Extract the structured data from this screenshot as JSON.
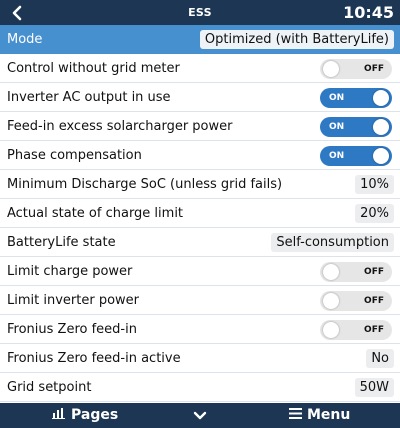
{
  "header": {
    "title": "ESS",
    "time": "10:45",
    "back_icon": "chevron-left-icon"
  },
  "rows": [
    {
      "label": "Mode",
      "kind": "value",
      "value": "Optimized (with BatteryLife)",
      "selected": true
    },
    {
      "label": "Control without grid meter",
      "kind": "toggle",
      "value": "OFF"
    },
    {
      "label": "Inverter AC output in use",
      "kind": "toggle",
      "value": "ON"
    },
    {
      "label": "Feed-in excess solarcharger power",
      "kind": "toggle",
      "value": "ON"
    },
    {
      "label": "Phase compensation",
      "kind": "toggle",
      "value": "ON"
    },
    {
      "label": "Minimum Discharge SoC (unless grid fails)",
      "kind": "value",
      "value": "10%"
    },
    {
      "label": "Actual state of charge limit",
      "kind": "value",
      "value": "20%"
    },
    {
      "label": "BatteryLife state",
      "kind": "value",
      "value": "Self-consumption"
    },
    {
      "label": "Limit charge power",
      "kind": "toggle",
      "value": "OFF"
    },
    {
      "label": "Limit inverter power",
      "kind": "toggle",
      "value": "OFF"
    },
    {
      "label": "Fronius Zero feed-in",
      "kind": "toggle",
      "value": "OFF"
    },
    {
      "label": "Fronius Zero feed-in active",
      "kind": "value",
      "value": "No"
    },
    {
      "label": "Grid setpoint",
      "kind": "value",
      "value": "50W"
    }
  ],
  "footer": {
    "pages_label": "Pages",
    "pages_icon": "bar-chart-icon",
    "scroll_icon": "chevron-down-icon",
    "menu_label": "Menu",
    "menu_icon": "hamburger-icon"
  },
  "colors": {
    "bar_background": "#1c3653",
    "selected_row": "#4790d0",
    "toggle_on": "#2e79c4",
    "toggle_off": "#e6e6e6",
    "value_box": "#ecedee"
  }
}
